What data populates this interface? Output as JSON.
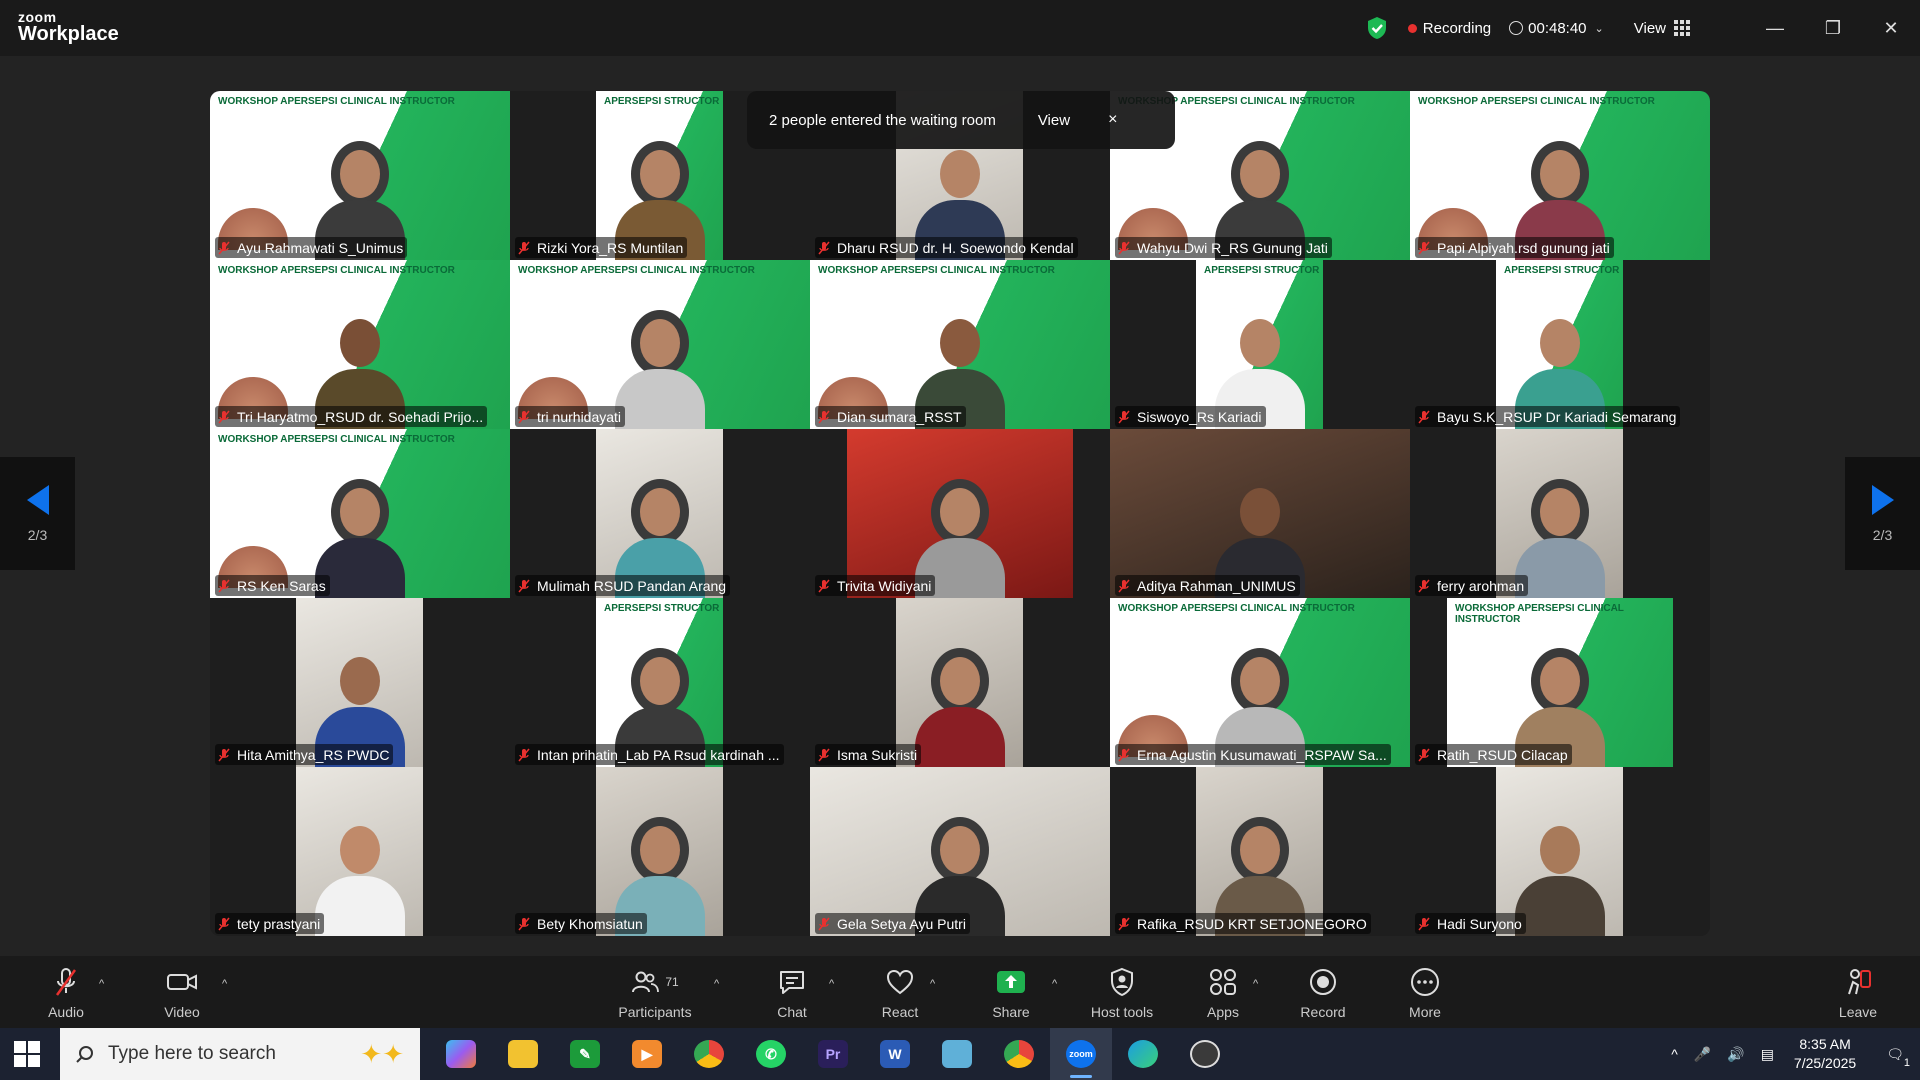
{
  "titlebar": {
    "logo_top": "zoom",
    "logo_bottom": "Workplace",
    "recording_label": "Recording",
    "timer": "00:48:40",
    "view_label": "View",
    "recording_color": "#e8312f",
    "shield_color": "#1db954"
  },
  "notification": {
    "message": "2 people entered the waiting room",
    "view_label": "View",
    "close_label": "×"
  },
  "pager": {
    "left_label": "2/3",
    "right_label": "2/3",
    "arrow_color": "#0e72ed"
  },
  "slide_title": "WORKSHOP APERSEPSI CLINICAL INSTRUCTOR",
  "slide_title_short": "APERSEPSI STRUCTOR",
  "participants": [
    {
      "name": "Ayu Rahmawati S_Unimus"
    },
    {
      "name": "Rizki Yora_RS Muntilan"
    },
    {
      "name": "Dharu RSUD dr. H. Soewondo Kendal"
    },
    {
      "name": "Wahyu Dwi R_RS Gunung Jati"
    },
    {
      "name": "Papi Alpiyah.rsd gunung jati"
    },
    {
      "name": "Tri Haryatmo_RSUD dr. Soehadi Prijo..."
    },
    {
      "name": "tri nurhidayati"
    },
    {
      "name": "Dian sumara_RSST"
    },
    {
      "name": "Siswoyo_Rs Kariadi"
    },
    {
      "name": "Bayu S.K_RSUP Dr Kariadi Semarang"
    },
    {
      "name": "RS Ken Saras"
    },
    {
      "name": "Mulimah RSUD Pandan Arang"
    },
    {
      "name": "Trivita Widiyani"
    },
    {
      "name": "Aditya Rahman_UNIMUS"
    },
    {
      "name": "ferry arohman"
    },
    {
      "name": "Hita Amithya_RS PWDC"
    },
    {
      "name": "Intan prihatin_Lab PA Rsud kardinah ..."
    },
    {
      "name": "Isma Sukristi"
    },
    {
      "name": "Erna Agustin Kusumawati_RSPAW Sa..."
    },
    {
      "name": "Ratih_RSUD Cilacap"
    },
    {
      "name": "tety prastyani"
    },
    {
      "name": "Bety Khomsiatun"
    },
    {
      "name": "Gela Setya Ayu Putri"
    },
    {
      "name": "Rafika_RSUD KRT SETJONEGORO"
    },
    {
      "name": "Hadi Suryono"
    }
  ],
  "toolbar": {
    "audio": "Audio",
    "video": "Video",
    "participants": "Participants",
    "participants_count": "71",
    "chat": "Chat",
    "react": "React",
    "share": "Share",
    "host_tools": "Host tools",
    "apps": "Apps",
    "record": "Record",
    "more": "More",
    "leave": "Leave",
    "share_color": "#1fb14f",
    "leave_color": "#e8312f"
  },
  "taskbar": {
    "search_placeholder": "Type here to search",
    "time": "8:35 AM",
    "date": "7/25/2025",
    "notification_count": "1",
    "apps": [
      {
        "icon": "copilot-icon",
        "color": "#7b5cf0"
      },
      {
        "icon": "file-explorer-icon",
        "color": "#f2c230"
      },
      {
        "icon": "excel-like-icon",
        "color": "#1c9b3a"
      },
      {
        "icon": "media-player-icon",
        "color": "#f28a2e"
      },
      {
        "icon": "chrome-icon",
        "color": "#e8453c"
      },
      {
        "icon": "whatsapp-icon",
        "color": "#25d366"
      },
      {
        "icon": "premiere-icon",
        "color": "#2a1f5a"
      },
      {
        "icon": "word-icon",
        "color": "#2b5bb5"
      },
      {
        "icon": "notepad-icon",
        "color": "#5fb0d8"
      },
      {
        "icon": "chrome-profile-icon",
        "color": "#e8453c"
      },
      {
        "icon": "zoom-icon",
        "color": "#0e72ed"
      },
      {
        "icon": "edge-icon",
        "color": "#1b9de2"
      },
      {
        "icon": "obs-icon",
        "color": "#3a3a3a"
      }
    ]
  }
}
